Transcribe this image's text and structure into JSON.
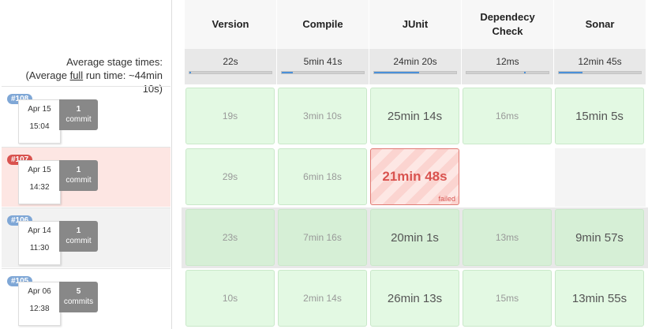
{
  "average": {
    "line1": "Average stage times:",
    "line2_prefix": "(Average ",
    "line2_link": "full",
    "line2_suffix": " run time: ~44min",
    "line3": "10s)"
  },
  "stages": [
    {
      "name": "Version",
      "avg": "22s",
      "bar_fraction": 0.02
    },
    {
      "name": "Compile",
      "avg": "5min 41s",
      "bar_fraction": 0.13
    },
    {
      "name": "JUnit",
      "avg": "24min 20s",
      "bar_fraction": 0.55
    },
    {
      "name": "Dependecy Check",
      "name_line1": "Dependecy",
      "name_line2": "Check",
      "avg": "12ms",
      "bar_fraction": 0.0
    },
    {
      "name": "Sonar",
      "avg": "12min 45s",
      "bar_fraction": 0.29
    }
  ],
  "builds": [
    {
      "number": "#108",
      "date": "Apr 15",
      "time": "15:04",
      "commits": "1",
      "commits_label": "commit",
      "cells": [
        "19s",
        "3min 10s",
        "25min 14s",
        "16ms",
        "15min 5s"
      ]
    },
    {
      "number": "#107",
      "date": "Apr 15",
      "time": "14:32",
      "commits": "1",
      "commits_label": "commit",
      "cells": [
        "29s",
        "6min 18s",
        "21min 48s",
        "",
        ""
      ],
      "failed_label": "failed"
    },
    {
      "number": "#106",
      "date": "Apr 14",
      "time": "11:30",
      "commits": "1",
      "commits_label": "commit",
      "cells": [
        "23s",
        "7min 16s",
        "20min 1s",
        "13ms",
        "9min 57s"
      ]
    },
    {
      "number": "#105",
      "date": "Apr 06",
      "time": "12:38",
      "commits": "5",
      "commits_label": "commits",
      "cells": [
        "10s",
        "2min 14s",
        "26min 13s",
        "15ms",
        "13min 55s"
      ]
    }
  ],
  "colors": {
    "success": "#e3f9e3",
    "failed": "#d9534f",
    "progress": "#4a90d9"
  }
}
